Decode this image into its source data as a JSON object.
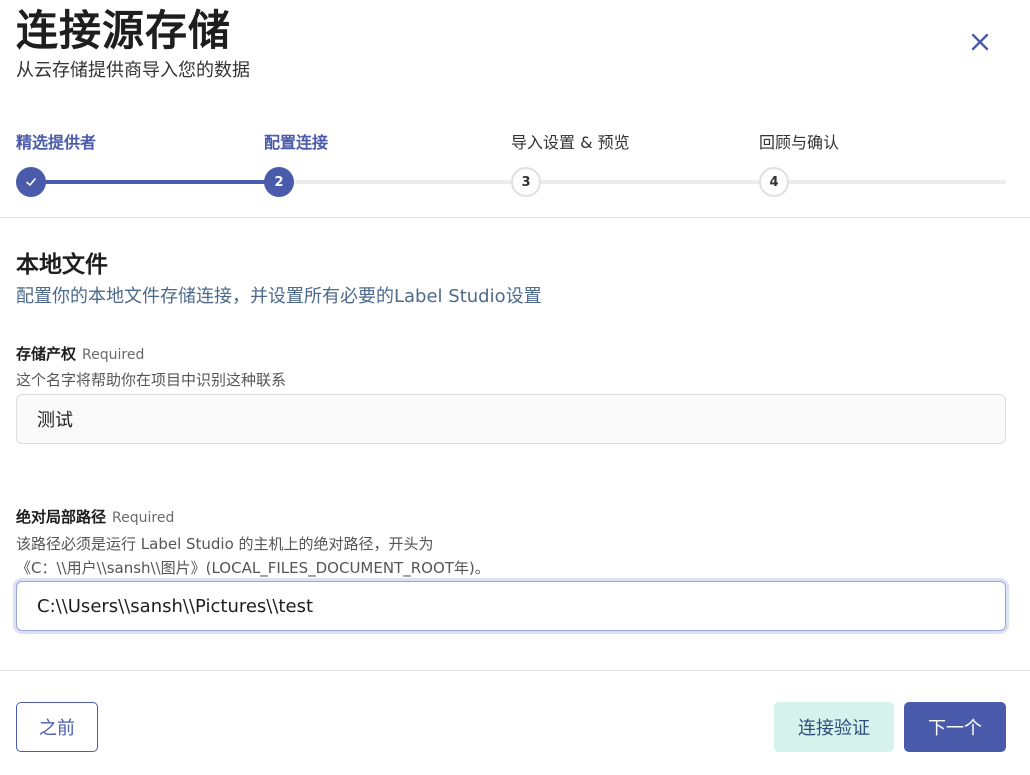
{
  "header": {
    "title": "连接源存储",
    "subtitle": "从云存储提供商导入您的数据"
  },
  "stepper": {
    "steps": [
      {
        "label": "精选提供者",
        "number": "",
        "status": "done"
      },
      {
        "label": "配置连接",
        "number": "2",
        "status": "current"
      },
      {
        "label": "导入设置 & 预览",
        "number": "3",
        "status": "pending"
      },
      {
        "label": "回顾与确认",
        "number": "4",
        "status": "pending"
      }
    ]
  },
  "section": {
    "title": "本地文件",
    "description": "配置你的本地文件存储连接，并设置所有必要的Label Studio设置"
  },
  "fields": {
    "storage_title": {
      "label": "存储产权",
      "required": "Required",
      "help": "这个名字将帮助你在项目中识别这种联系",
      "value": "测试"
    },
    "local_path": {
      "label": "绝对局部路径",
      "required": "Required",
      "help_line1": "该路径必须是运行 Label Studio 的主机上的绝对路径，开头为",
      "help_line2": "《C：\\\\用户\\\\sansh\\\\图片》(LOCAL_FILES_DOCUMENT_ROOT年)。",
      "value": "C:\\\\Users\\\\sansh\\\\Pictures\\\\test"
    }
  },
  "footer": {
    "back_label": "之前",
    "verify_label": "连接验证",
    "next_label": "下一个"
  },
  "colors": {
    "accent": "#4a5bab",
    "verify_bg": "#d6f2ec",
    "description": "#4d6a8c"
  },
  "icons": {
    "close": "close-icon",
    "check": "check-icon"
  }
}
